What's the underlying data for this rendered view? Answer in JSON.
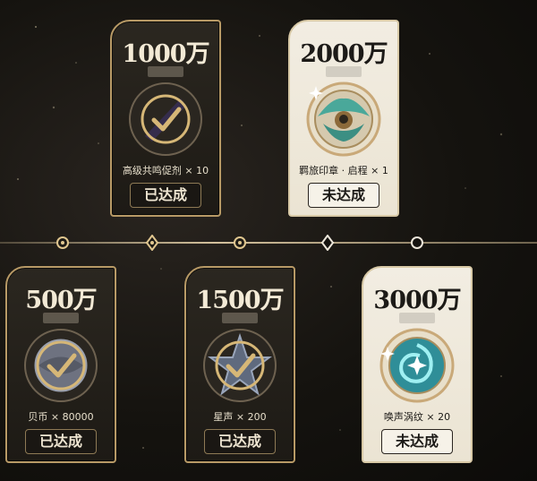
{
  "milestones": [
    {
      "amount": "1000万",
      "reward": "高级共鸣促剂 × 10",
      "status": "已达成",
      "achieved": true
    },
    {
      "amount": "2000万",
      "reward": "羁旅印章 · 启程 × 1",
      "status": "未达成",
      "achieved": false
    },
    {
      "amount": "500万",
      "reward": "贝币 × 80000",
      "status": "已达成",
      "achieved": true
    },
    {
      "amount": "1500万",
      "reward": "星声 × 200",
      "status": "已达成",
      "achieved": true
    },
    {
      "amount": "3000万",
      "reward": "唤声涡纹 × 20",
      "status": "未达成",
      "achieved": false
    }
  ],
  "icons": [
    "checkmark-badge-icon",
    "stamp-item-icon",
    "shell-coin-icon",
    "astrite-star-icon",
    "vortex-orb-icon"
  ],
  "colors": {
    "gold": "#b89a66",
    "dark_card": "#1d1a15",
    "light_card": "#efe9dc"
  }
}
